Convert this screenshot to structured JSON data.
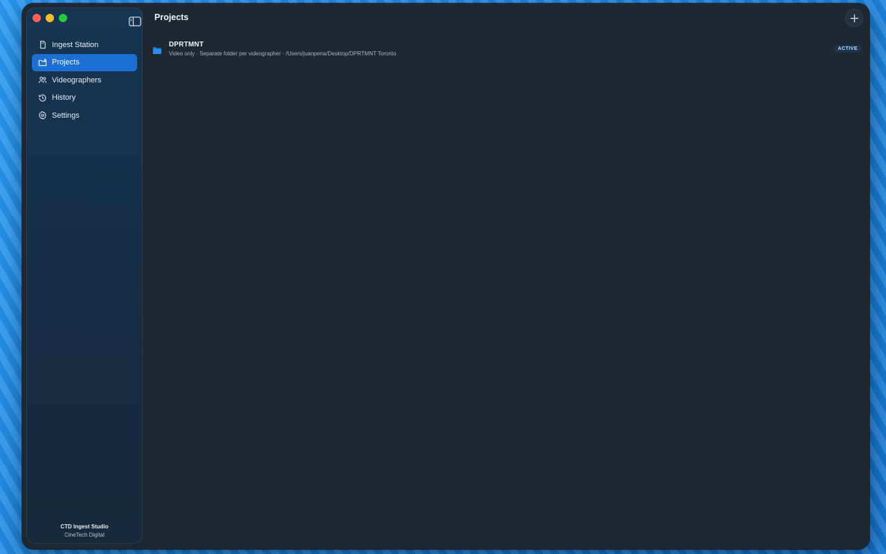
{
  "app": {
    "name": "CTD Ingest Studio",
    "company": "CineTech Digital"
  },
  "sidebar": {
    "items": [
      {
        "label": "Ingest Station",
        "icon": "sd-card-icon",
        "active": false
      },
      {
        "label": "Projects",
        "icon": "folder-icon",
        "active": true
      },
      {
        "label": "Videographers",
        "icon": "people-icon",
        "active": false
      },
      {
        "label": "History",
        "icon": "clock-history-icon",
        "active": false
      },
      {
        "label": "Settings",
        "icon": "gear-icon",
        "active": false
      }
    ]
  },
  "header": {
    "title": "Projects",
    "add_icon": "plus-icon"
  },
  "projects": [
    {
      "name": "DPRTMNT",
      "meta": "Video only · Separate folder per videographer · /Users/juanpena/Desktop/DPRTMNT Toronto",
      "status": "ACTIVE"
    }
  ],
  "colors": {
    "accent": "#1e6fd4",
    "window_bg": "#1f2831",
    "sidebar_bg": "#163552",
    "badge_bg": "#1b3550",
    "desktop": "#1f8ff0"
  }
}
